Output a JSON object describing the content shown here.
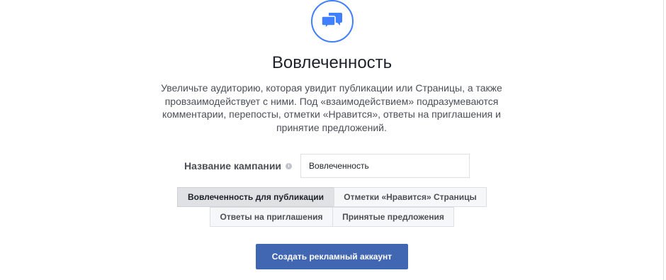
{
  "objective": {
    "icon": "chat-bubbles-icon",
    "title": "Вовлеченность",
    "description": "Увеличьте аудиторию, которая увидит публикации или Страницы, а также провзаимодействует с ними. Под «взаимодействием» подразумеваются комментарии, перепосты, отметки «Нравится», ответы на приглашения и принятие предложений."
  },
  "form": {
    "campaign_name_label": "Название кампании",
    "info_icon": "info-icon",
    "campaign_name_value": "Вовлеченность"
  },
  "engagement_options": [
    {
      "label": "Вовлеченность для публикации",
      "selected": true
    },
    {
      "label": "Отметки «Нравится» Страницы",
      "selected": false
    },
    {
      "label": "Ответы на приглашения",
      "selected": false
    },
    {
      "label": "Принятые предложения",
      "selected": false
    }
  ],
  "actions": {
    "create_account_label": "Создать рекламный аккаунт"
  },
  "colors": {
    "accent": "#4080ff",
    "primary_button": "#4267b2"
  }
}
